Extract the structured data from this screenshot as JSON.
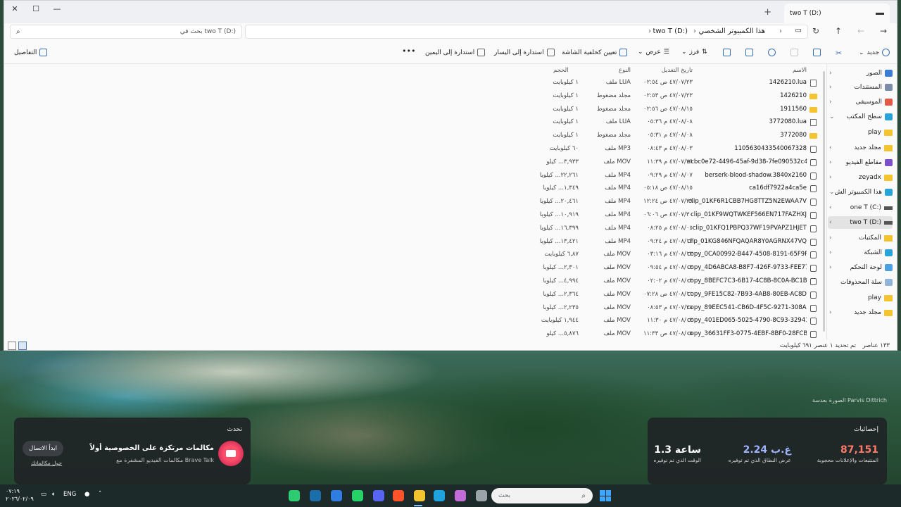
{
  "window": {
    "tab_title": "two T (D:)",
    "new_tab_symbol": "+",
    "close_symbol": "✕"
  },
  "address": {
    "search_placeholder": "بحث في two T (D:)",
    "breadcrumbs": [
      "هذا الكمبيوتر الشخصي",
      "two T (D:)"
    ]
  },
  "toolbar": {
    "new_label": "جديد",
    "sort_label": "فرز",
    "view_label": "عرض",
    "set_background_label": "تعيين كخلفية الشاشة",
    "rotate_left_label": "استدارة إلى اليسار",
    "rotate_right_label": "استدارة إلى اليمين",
    "more_label": "•••",
    "details_label": "التفاصيل"
  },
  "nav": {
    "items": [
      {
        "label": "الصور",
        "kind": "lib",
        "color": "#3a7bd5"
      },
      {
        "label": "المستندات",
        "kind": "lib",
        "color": "#7a8ca8"
      },
      {
        "label": "الموسيقى",
        "kind": "lib",
        "color": "#e05a47"
      },
      {
        "label": "سطح المكتب",
        "kind": "lib",
        "color": "#2aa3d8"
      },
      {
        "label": "play",
        "kind": "folder",
        "color": "#f4c430"
      },
      {
        "label": "مجلد جديد",
        "kind": "folder",
        "color": "#f4c430"
      },
      {
        "label": "مقاطع الفيديو",
        "kind": "lib",
        "color": "#7b4fc9"
      },
      {
        "label": "zeyadx",
        "kind": "folder",
        "color": "#f4c430"
      },
      {
        "label": "هذا الكمبيوتر الش",
        "kind": "lib",
        "color": "#2aa3d8"
      },
      {
        "label": "one T (C:)",
        "kind": "drive",
        "color": "#555555"
      },
      {
        "label": "two T (D:)",
        "kind": "drive",
        "color": "#555555"
      },
      {
        "label": "المكتبات",
        "kind": "folder",
        "color": "#f4c430"
      },
      {
        "label": "الشبكة",
        "kind": "lib",
        "color": "#2aa3d8"
      },
      {
        "label": "لوحة التحكم",
        "kind": "lib",
        "color": "#4aa0e0"
      },
      {
        "label": "سلة المحذوفات",
        "kind": "lib",
        "color": "#8fb3d9"
      },
      {
        "label": "play",
        "kind": "folder",
        "color": "#f4c430"
      },
      {
        "label": "مجلد جديد",
        "kind": "folder",
        "color": "#f4c430"
      }
    ]
  },
  "files": {
    "headers": {
      "name": "الاسم",
      "date": "تاريخ التعديل",
      "type": "النوع",
      "size": "الحجم"
    },
    "rows": [
      {
        "name": "1426210.lua",
        "date": "٤٧/٠٧/٢٣ ص ٠٢:٥٤",
        "type": "ملف LUA",
        "size": "١ كيلوبايت",
        "icon": "file"
      },
      {
        "name": "1426210",
        "date": "٤٧/٠٧/٢٣ ص ٠٢:٥٣",
        "type": "مجلد مضغوط",
        "size": "١ كيلوبايت",
        "icon": "folder"
      },
      {
        "name": "1911560",
        "date": "٤٧/٠٨/١٥ ص ٠٢:٥٦",
        "type": "مجلد مضغوط",
        "size": "١ كيلوبايت",
        "icon": "folder"
      },
      {
        "name": "3772080.lua",
        "date": "٤٧/٠٨/٠٨ م ٠٥:٣٦",
        "type": "ملف LUA",
        "size": "١ كيلوبايت",
        "icon": "file"
      },
      {
        "name": "3772080",
        "date": "٤٧/٠٨/٠٨ م ٠٥:٣١",
        "type": "مجلد مضغوط",
        "size": "١ كيلوبايت",
        "icon": "folder"
      },
      {
        "name": "1105630433540067328",
        "date": "٤٧/٠٨/٠٣ م ٠٨:٤٣",
        "type": "ملف MP3",
        "size": "٦٠ كيلوبايت",
        "icon": "media"
      },
      {
        "name": "acbc0e72-4496-45af-9d38-7fe090532c42",
        "date": "٤٧/٠٧/٢٦ م ١١:٣٩",
        "type": "ملف MOV",
        "size": "٣,٩٣٣... كيلو",
        "icon": "media"
      },
      {
        "name": "berserk-blood-shadow.3840x2160",
        "date": "٤٧/٠٨/٠٧ م ٠٩:٢٩",
        "type": "ملف MP4",
        "size": "٢٢,٢٦١... كيلوبا",
        "icon": "media"
      },
      {
        "name": "ca16df7922a4ca5e",
        "date": "٤٧/٠٨/١٥ ص ٠٥:١٨",
        "type": "ملف MP4",
        "size": "١,٣٤٩... كيلوبا",
        "icon": "media"
      },
      {
        "name": "clip_01KF6R1CBB7HG8TTZ5N2EWAA7V",
        "date": "٤٧/٠٧/٢٩ ص ١٢:٢٤",
        "type": "ملف MP4",
        "size": "٢٠,٤٦١... كيلوبا",
        "icon": "media"
      },
      {
        "name": "clip_01KF9WQTWKEF566EN717FAZHXJ",
        "date": "٤٧/٠٧/٣٠ ص ٠٦:٠٦",
        "type": "ملف MP4",
        "size": "١٠,٩١٩... كيلوبا",
        "icon": "media"
      },
      {
        "name": "clip_01KFQ1PBPQ37WF19PVAPZ1HJET",
        "date": "٤٧/٠٨/٠٥ م ٠٨:٢٥",
        "type": "ملف MP4",
        "size": "١٦,٣٩٩... كيلوبا",
        "icon": "media"
      },
      {
        "name": "clip_01KG846NFQAQAR8Y0AGRNX47VQ",
        "date": "٤٧/٠٨/١٣ م ٠٩:٢٤",
        "type": "ملف MP4",
        "size": "١٣,٤٢١... كيلوبا",
        "icon": "media"
      },
      {
        "name": "copy_0CA00992-B447-4508-8191-65F9F6...",
        "date": "٤٧/٠٨/١٣ م ٠٣:١٦",
        "type": "ملف MOV",
        "size": "٦,٨٧ كيلوبايت",
        "icon": "media"
      },
      {
        "name": "copy_4D6ABCA8-B8F7-426F-9733-FEE776...",
        "date": "٤٧/٠٨/٠٣ م ٠٩:٥٤",
        "type": "ملف MOV",
        "size": "٢,٣٠١... كيلوبا",
        "icon": "media"
      },
      {
        "name": "copy_8BEFC7C3-6B17-4C8B-8C0A-BC1B...",
        "date": "٤٧/٠٨/٠٣ م ٠٢:٠٢",
        "type": "ملف MOV",
        "size": "٤,٩٩٤... كيلوبا",
        "icon": "media"
      },
      {
        "name": "copy_9FE15C82-7B93-4AB8-80EB-AC8D9...",
        "date": "٤٧/٠٨/١١ ص ٠٧:٢٨",
        "type": "ملف MOV",
        "size": "٢,٣٦٤... كيلوبا",
        "icon": "media"
      },
      {
        "name": "copy_89EEC541-CB6D-4F5C-9271-308AB...",
        "date": "٤٧/٠٧/٢٨ م ٠٨:٥٣",
        "type": "ملف MOV",
        "size": "٢,٢٣٥... كيلوبا",
        "icon": "media"
      },
      {
        "name": "copy_401ED065-5025-4790-8C93-32941D...",
        "date": "٤٧/٠٨/٠٣ م ١١:٣٠",
        "type": "ملف MOV",
        "size": "١,٩٤٤ كيلوبايت",
        "icon": "media"
      },
      {
        "name": "copy_36631FF3-0775-4EBF-8BF0-28FCB7...",
        "date": "٤٧/٠٨/٠٥ ص ١١:٣٣",
        "type": "ملف MOV",
        "size": "٥,٨٧٦... كيلو",
        "icon": "media"
      }
    ]
  },
  "status": {
    "item_count": "١٣٣ عناصر",
    "selection": "تم تحديد ١ عنصر ٦٩١ كيلوبايت"
  },
  "wallpaper": {
    "credit": "الصورة بعدسة Parvis Dittrich"
  },
  "stats_widget": {
    "title": "إحصائيات",
    "blocked_value": "87,151",
    "blocked_label": "المتتبعات والإعلانات محجوبة",
    "bandwidth_value": "2.24 غ.ب",
    "bandwidth_label": "عرض النطاق الذي تم توفيره",
    "time_value": "1.3 ساعة",
    "time_label": "الوقت الذي تم توفيره",
    "colors": {
      "blocked": "#ff7a6b",
      "bandwidth": "#9fb3ff",
      "time": "#ffffff"
    }
  },
  "talk_widget": {
    "title": "تحدث",
    "headline": "مكالمات مرتكزة على الخصوصية أولاً",
    "subtitle": "مكالمات الفيديو المشفرة مع Brave Talk",
    "connect_label": "ابدأ الاتصال",
    "about_label": "حول مكالماتك"
  },
  "taskbar": {
    "search_placeholder": "بحث",
    "lang": "ENG",
    "time": "٠٧:١٩",
    "date": "٢٠٢٦/٠٢/٠٩",
    "apps": [
      {
        "name": "media-player-app",
        "color": "#2ecc71"
      },
      {
        "name": "steam-app",
        "color": "#1b6fa8"
      },
      {
        "name": "sync-app",
        "color": "#2f7de1"
      },
      {
        "name": "whatsapp-app",
        "color": "#25d366"
      },
      {
        "name": "discord-app",
        "color": "#5865f2"
      },
      {
        "name": "brave-app",
        "color": "#fb542b"
      },
      {
        "name": "file-explorer-app",
        "color": "#f4c430"
      },
      {
        "name": "edge-app",
        "color": "#1fa3e0"
      },
      {
        "name": "copilot-app",
        "color": "#c26bd9"
      },
      {
        "name": "task-view-app",
        "color": "#9aa4a8"
      }
    ]
  }
}
